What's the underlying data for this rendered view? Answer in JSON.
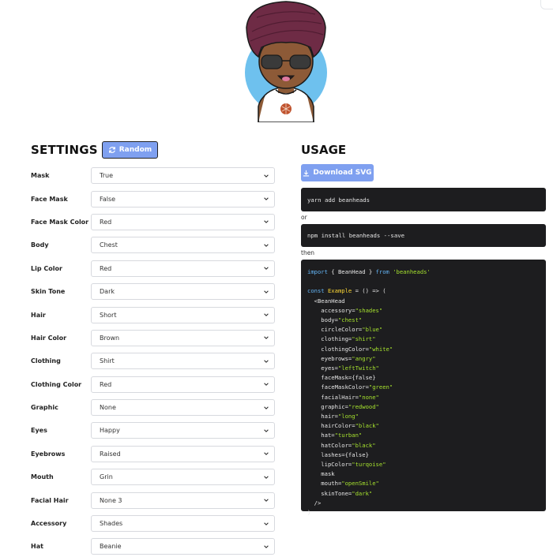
{
  "settings": {
    "title": "SETTINGS",
    "random_label": "Random",
    "rows": [
      {
        "label": "Mask",
        "value": "True"
      },
      {
        "label": "Face Mask",
        "value": "False"
      },
      {
        "label": "Face Mask Color",
        "value": "Red"
      },
      {
        "label": "Body",
        "value": "Chest"
      },
      {
        "label": "Lip Color",
        "value": "Red"
      },
      {
        "label": "Skin Tone",
        "value": "Dark"
      },
      {
        "label": "Hair",
        "value": "Short"
      },
      {
        "label": "Hair Color",
        "value": "Brown"
      },
      {
        "label": "Clothing",
        "value": "Shirt"
      },
      {
        "label": "Clothing Color",
        "value": "Red"
      },
      {
        "label": "Graphic",
        "value": "None"
      },
      {
        "label": "Eyes",
        "value": "Happy"
      },
      {
        "label": "Eyebrows",
        "value": "Raised"
      },
      {
        "label": "Mouth",
        "value": "Grin"
      },
      {
        "label": "Facial Hair",
        "value": "None 3"
      },
      {
        "label": "Accessory",
        "value": "Shades"
      },
      {
        "label": "Hat",
        "value": "Beanie"
      }
    ]
  },
  "usage": {
    "title": "USAGE",
    "download_label": "Download SVG",
    "install_yarn": "yarn add beanheads",
    "or_text": "or",
    "install_npm": "npm install beanheads --save",
    "then_text": "then",
    "code": {
      "import_kw": "import",
      "import_mid": " { BeanHead } ",
      "from_kw": "from",
      "module": "'beanheads'",
      "const_kw": "const",
      "component_name": "Example",
      "arrow": " = () => (",
      "open_tag": "  <BeanHead",
      "props": [
        {
          "name": "accessory",
          "value": "\"shades\"",
          "kind": "str"
        },
        {
          "name": "body",
          "value": "\"chest\"",
          "kind": "str"
        },
        {
          "name": "circleColor",
          "value": "\"blue\"",
          "kind": "str"
        },
        {
          "name": "clothing",
          "value": "\"shirt\"",
          "kind": "str"
        },
        {
          "name": "clothingColor",
          "value": "\"white\"",
          "kind": "str"
        },
        {
          "name": "eyebrows",
          "value": "\"angry\"",
          "kind": "str"
        },
        {
          "name": "eyes",
          "value": "\"leftTwitch\"",
          "kind": "str"
        },
        {
          "name": "faceMask",
          "value": "{false}",
          "kind": "plain"
        },
        {
          "name": "faceMaskColor",
          "value": "\"green\"",
          "kind": "str"
        },
        {
          "name": "facialHair",
          "value": "\"none\"",
          "kind": "str"
        },
        {
          "name": "graphic",
          "value": "\"redwood\"",
          "kind": "str"
        },
        {
          "name": "hair",
          "value": "\"long\"",
          "kind": "str"
        },
        {
          "name": "hairColor",
          "value": "\"black\"",
          "kind": "str"
        },
        {
          "name": "hat",
          "value": "\"turban\"",
          "kind": "str"
        },
        {
          "name": "hatColor",
          "value": "\"black\"",
          "kind": "str"
        },
        {
          "name": "lashes",
          "value": "{false}",
          "kind": "plain"
        },
        {
          "name": "lipColor",
          "value": "\"turqoise\"",
          "kind": "str"
        },
        {
          "name": "mask",
          "value": "",
          "kind": "plain"
        },
        {
          "name": "mouth",
          "value": "\"openSmile\"",
          "kind": "str"
        },
        {
          "name": "skinTone",
          "value": "\"dark\"",
          "kind": "str"
        }
      ],
      "close_tag": "  />",
      "close_paren": ")"
    }
  },
  "icons": {
    "random": "refresh-icon",
    "download": "download-icon",
    "select": "chevron-down-icon"
  },
  "colors": {
    "accent": "#7fa0f0",
    "code_bg": "#1d1d1f",
    "turban": "#6e2b45",
    "skin": "#8d5a37",
    "circle": "#6ec1ee",
    "graphic": "#c0532e"
  }
}
